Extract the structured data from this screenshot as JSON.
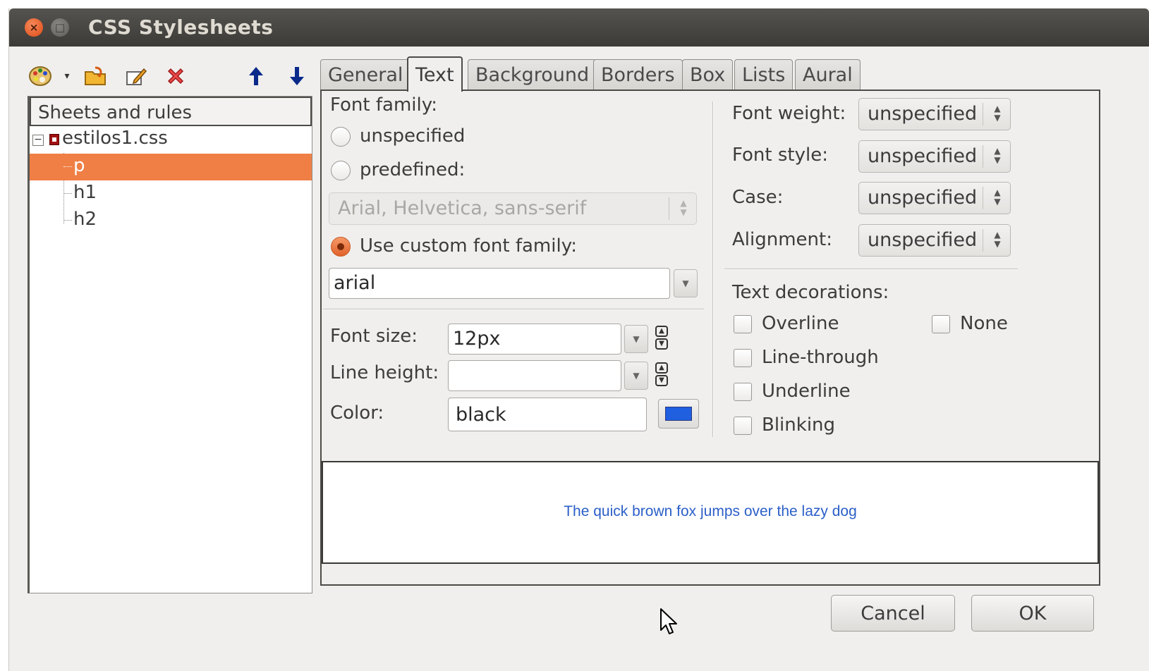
{
  "window": {
    "title": "CSS Stylesheets"
  },
  "titlebar": {
    "close_icon": "close-icon",
    "maximize_icon": "maximize-icon"
  },
  "toolbar": {
    "icons": [
      "palette-icon",
      "dropdown-arrow-icon",
      "import-folder-icon",
      "edit-icon",
      "delete-icon",
      "move-up-icon",
      "move-down-icon"
    ]
  },
  "tree": {
    "header": "Sheets and rules",
    "file": {
      "expander": "−",
      "name": "estilos1.css"
    },
    "rules": [
      "p",
      "h1",
      "h2"
    ],
    "selected_rule": "p"
  },
  "tabs": [
    "General",
    "Text",
    "Background",
    "Borders",
    "Box",
    "Lists",
    "Aural"
  ],
  "active_tab": "Text",
  "font_family": {
    "label": "Font family:",
    "opt_unspecified": "unspecified",
    "opt_predefined": "predefined:",
    "predefined_value": "Arial, Helvetica, sans-serif",
    "opt_custom": "Use custom font family:",
    "custom_value": "arial",
    "selected": "custom"
  },
  "font_size": {
    "label": "Font size:",
    "value": "12px"
  },
  "line_height": {
    "label": "Line height:",
    "value": ""
  },
  "color": {
    "label": "Color:",
    "value": "black",
    "swatch": "#1f5fe0"
  },
  "font_weight": {
    "label": "Font weight:",
    "value": "unspecified"
  },
  "font_style": {
    "label": "Font style:",
    "value": "unspecified"
  },
  "case": {
    "label": "Case:",
    "value": "unspecified"
  },
  "alignment": {
    "label": "Alignment:",
    "value": "unspecified"
  },
  "decorations": {
    "label": "Text decorations:",
    "overline": "Overline",
    "none": "None",
    "line_through": "Line-through",
    "underline": "Underline",
    "blinking": "Blinking"
  },
  "preview": {
    "text": "The quick brown fox jumps over the lazy dog",
    "color": "#2b5fc8"
  },
  "buttons": {
    "cancel": "Cancel",
    "ok": "OK"
  },
  "colors": {
    "accent": "#ef7f45",
    "titlebar": "#3c3b37",
    "window_bg": "#f0efee"
  }
}
